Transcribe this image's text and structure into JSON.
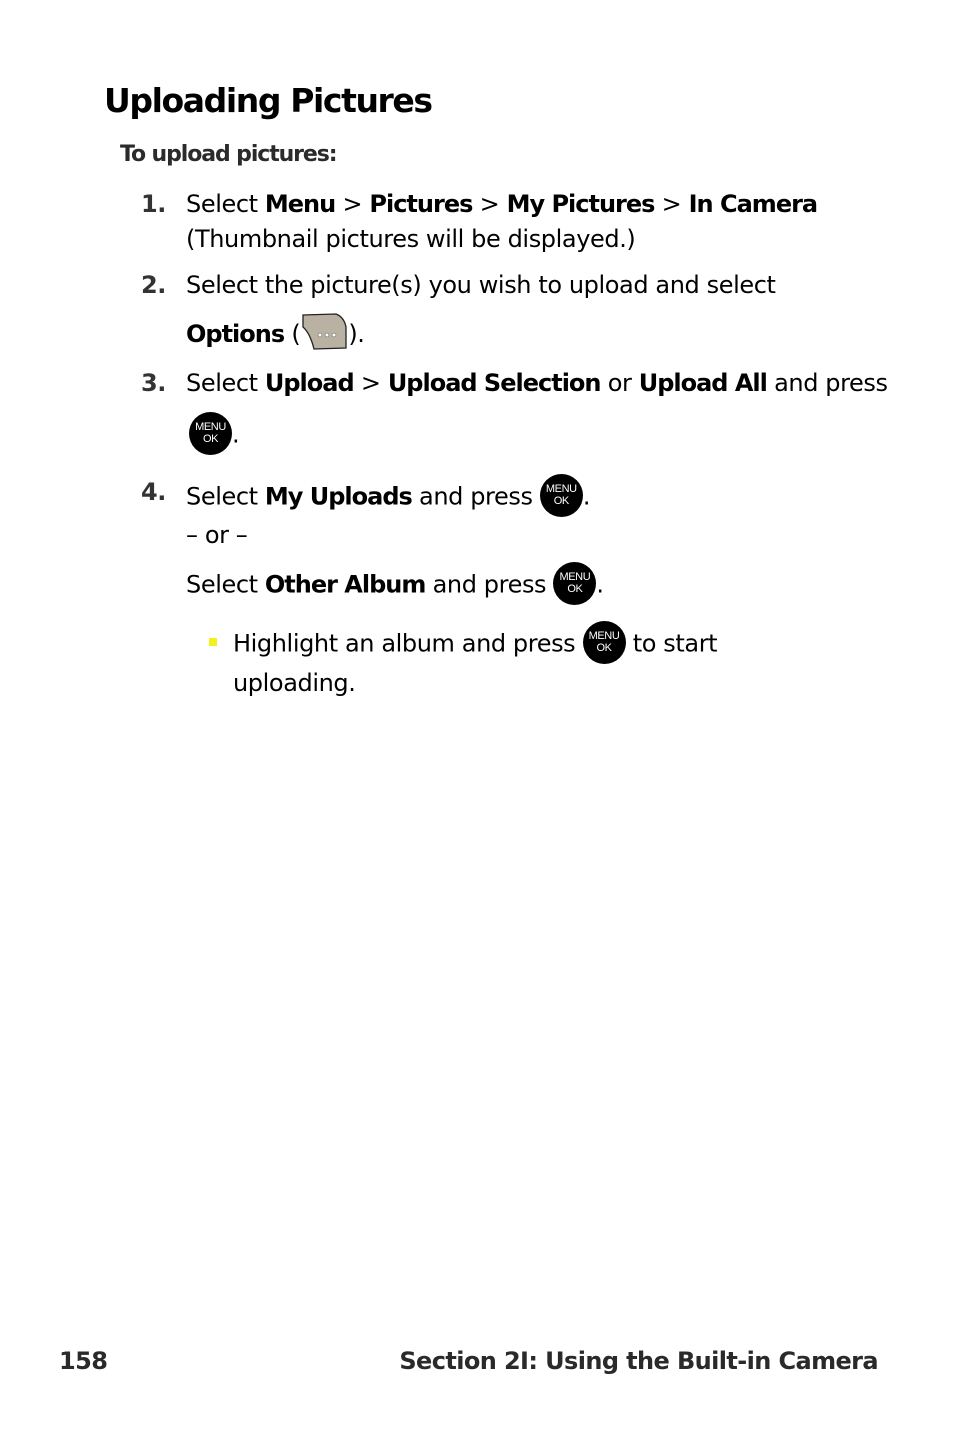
{
  "title": "Uploading Pictures",
  "subhead": "To upload pictures:",
  "steps": [
    {
      "num": "1.",
      "line1": {
        "t0": "Select ",
        "b0": "Menu",
        "s0": " > ",
        "b1": "Pictures",
        "s1": " > ",
        "b2": "My Pictures",
        "s2": " > ",
        "b3": "In Camera"
      },
      "line2": "(Thumbnail pictures will be displayed.)"
    },
    {
      "num": "2.",
      "line1": "Select the picture(s) you wish to upload and select",
      "line2": {
        "b0": "Options",
        "t0": " (",
        "icon": "options-softkey-icon",
        "t1": ")."
      }
    },
    {
      "num": "3.",
      "line1": {
        "t0": "Select ",
        "b0": "Upload",
        "s0": " > ",
        "b1": "Upload Selection",
        "t1": " or ",
        "b2": "Upload All",
        "t2": " and press"
      },
      "line2": {
        "icon": "menu-ok-key-icon",
        "t0": "."
      }
    },
    {
      "num": "4.",
      "line1": {
        "t0": "Select ",
        "b0": "My Uploads",
        "t1": " and press ",
        "icon": "menu-ok-key-icon",
        "t2": "."
      },
      "or": "– or –",
      "line3": {
        "t0": "Select ",
        "b0": "Other Album",
        "t1": " and press ",
        "icon": "menu-ok-key-icon",
        "t2": "."
      },
      "bullet": {
        "t0": "Highlight an album and press ",
        "icon": "menu-ok-key-icon",
        "t1": " to start",
        "line2": "uploading.",
        "bullet_color": "#f5f020"
      }
    }
  ],
  "menu_ok_key": {
    "top": "MENU",
    "bottom": "OK"
  },
  "footer": {
    "page_number": "158",
    "section": "Section 2I: Using the Built-in Camera"
  }
}
